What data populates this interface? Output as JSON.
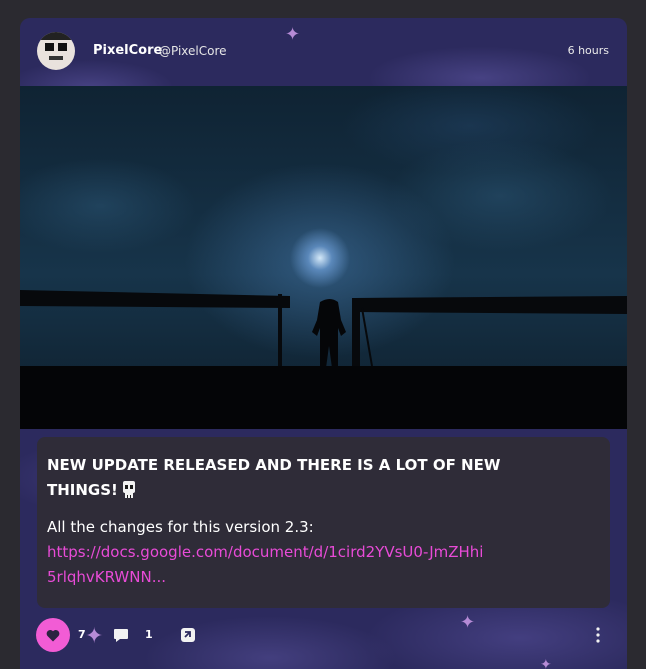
{
  "post": {
    "author_name": "PixelCore",
    "author_handle": "@PixelCore",
    "timestamp": "6 hours",
    "title": "NEW UPDATE RELEASED AND THERE IS A LOT OF NEW THINGS!",
    "title_emoji": "skull-icon",
    "body": "All the changes for this version 2.3:",
    "link": "https://docs.google.com/document/d/1cird2YVsU0-JmZHhi5rlqhvKRWNN..."
  },
  "actions": {
    "likes": "7",
    "comments": "1",
    "like_icon": "heart-icon",
    "comment_icon": "speech-bubble-icon",
    "share_icon": "share-icon",
    "more_icon": "more-vertical-icon"
  },
  "colors": {
    "accent": "#f25cd5",
    "link": "#e84bd7",
    "card_bg": "#2c2a5e",
    "post_box_bg": "#2f2c38"
  }
}
